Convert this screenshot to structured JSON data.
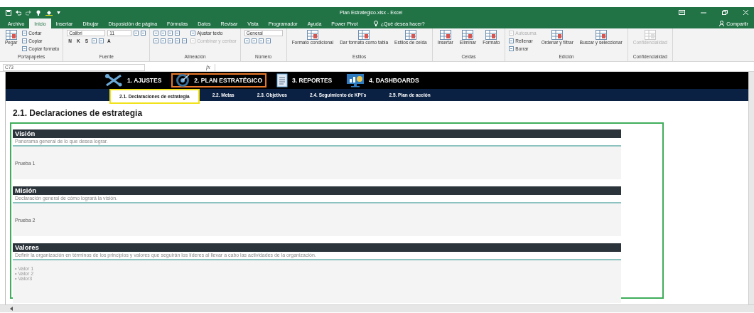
{
  "window": {
    "title": "Plan Estrategico.xlsx  -  Excel"
  },
  "ribbon_tabs": [
    {
      "label": "Archivo",
      "selected": false
    },
    {
      "label": "Inicio",
      "selected": true
    },
    {
      "label": "Insertar",
      "selected": false
    },
    {
      "label": "Dibujar",
      "selected": false
    },
    {
      "label": "Disposición de página",
      "selected": false
    },
    {
      "label": "Fórmulas",
      "selected": false
    },
    {
      "label": "Datos",
      "selected": false
    },
    {
      "label": "Revisar",
      "selected": false
    },
    {
      "label": "Vista",
      "selected": false
    },
    {
      "label": "Programador",
      "selected": false
    },
    {
      "label": "Ayuda",
      "selected": false
    },
    {
      "label": "Power Pivot",
      "selected": false
    }
  ],
  "tell_me": "¿Qué desea hacer?",
  "share": "Compartir",
  "ribbon_groups": [
    {
      "label": "Portapapeles",
      "columns": [
        [
          [
            {
              "kind": "large",
              "label": "Pegar",
              "disabled": false
            }
          ]
        ],
        [
          [
            {
              "kind": "small",
              "label": "Cortar",
              "disabled": false
            }
          ],
          [
            {
              "kind": "small",
              "label": "Copiar",
              "disabled": false
            }
          ],
          [
            {
              "kind": "small",
              "label": "Copiar formato",
              "disabled": false
            }
          ]
        ]
      ]
    },
    {
      "label": "Fuente",
      "columns": [
        [
          [
            {
              "kind": "field",
              "value": "Calibri"
            },
            {
              "kind": "field",
              "value": "11"
            },
            {
              "kind": "icon"
            },
            {
              "kind": "icon"
            }
          ],
          [
            {
              "kind": "glyph",
              "text": "N"
            },
            {
              "kind": "glyph",
              "text": "K"
            },
            {
              "kind": "glyph",
              "text": "S"
            },
            {
              "kind": "icon"
            },
            {
              "kind": "icon"
            },
            {
              "kind": "glyph",
              "text": "A"
            }
          ]
        ]
      ]
    },
    {
      "label": "Alineación",
      "columns": [
        [
          [
            {
              "kind": "icon"
            },
            {
              "kind": "icon"
            },
            {
              "kind": "icon"
            },
            {
              "kind": "icon"
            }
          ],
          [
            {
              "kind": "icon"
            },
            {
              "kind": "icon"
            },
            {
              "kind": "icon"
            },
            {
              "kind": "icon"
            },
            {
              "kind": "icon"
            }
          ]
        ],
        [
          [
            {
              "kind": "small",
              "label": "Ajustar texto",
              "disabled": false
            }
          ],
          [
            {
              "kind": "small",
              "label": "Combinar y centrar",
              "disabled": true
            }
          ]
        ]
      ]
    },
    {
      "label": "Número",
      "columns": [
        [
          [
            {
              "kind": "field",
              "value": "General"
            }
          ],
          [
            {
              "kind": "icon"
            },
            {
              "kind": "icon"
            },
            {
              "kind": "icon"
            },
            {
              "kind": "icon"
            }
          ]
        ]
      ]
    },
    {
      "label": "Estilos",
      "columns": [
        [
          [
            {
              "kind": "large",
              "label": "Formato condicional",
              "disabled": false
            }
          ]
        ],
        [
          [
            {
              "kind": "large",
              "label": "Dar formato como tabla",
              "disabled": false
            }
          ]
        ],
        [
          [
            {
              "kind": "large",
              "label": "Estilos de celda",
              "disabled": false
            }
          ]
        ]
      ]
    },
    {
      "label": "Celdas",
      "columns": [
        [
          [
            {
              "kind": "large",
              "label": "Insertar",
              "disabled": false
            }
          ]
        ],
        [
          [
            {
              "kind": "large",
              "label": "Eliminar",
              "disabled": false
            }
          ]
        ],
        [
          [
            {
              "kind": "large",
              "label": "Formato",
              "disabled": false
            }
          ]
        ]
      ]
    },
    {
      "label": "Edición",
      "columns": [
        [
          [
            {
              "kind": "small",
              "label": "Autosuma",
              "disabled": true
            }
          ],
          [
            {
              "kind": "small",
              "label": "Rellenar",
              "disabled": false
            }
          ],
          [
            {
              "kind": "small",
              "label": "Borrar",
              "disabled": false
            }
          ]
        ],
        [
          [
            {
              "kind": "large",
              "label": "Ordenar y filtrar",
              "disabled": false
            }
          ]
        ],
        [
          [
            {
              "kind": "large",
              "label": "Buscar y seleccionar",
              "disabled": false
            }
          ]
        ]
      ]
    },
    {
      "label": "Confidencialidad",
      "columns": [
        [
          [
            {
              "kind": "large",
              "label": "Confidencialidad",
              "disabled": true
            }
          ]
        ]
      ]
    }
  ],
  "formula_bar": {
    "name_box": "C73",
    "function_label": "fx"
  },
  "sheet_nav": [
    {
      "label": "1. AJUSTES",
      "selected": false
    },
    {
      "label": "2. PLAN ESTRATÉGICO",
      "selected": true
    },
    {
      "label": "3. REPORTES",
      "selected": false
    },
    {
      "label": "4. DASHBOARDS",
      "selected": false
    }
  ],
  "sub_nav": [
    {
      "label": "2.1. Declaraciones de estrategia",
      "selected": true
    },
    {
      "label": "2.2. Metas",
      "selected": false
    },
    {
      "label": "2.3. Objetivos",
      "selected": false
    },
    {
      "label": "2.4. Seguimiento de KPI´s",
      "selected": false
    },
    {
      "label": "2.5. Plan de acción",
      "selected": false
    }
  ],
  "heading": "2.1. Declaraciones de estrategia",
  "sections": [
    {
      "title": "Visión",
      "description": "Panorama general de lo que desea lograr.",
      "content": [
        "Prueba 1"
      ]
    },
    {
      "title": "Misión",
      "description": "Declaración general de cómo logrará la visión.",
      "content": [
        "Prueba 2"
      ]
    },
    {
      "title": "Valores",
      "description": "Definir la organización en términos de los principios y valores que seguirán los líderes al llevar a cabo las actividades de la organización.",
      "content": [
        "• Valor 1",
        "• Valor 2",
        "• Valor3"
      ]
    }
  ]
}
